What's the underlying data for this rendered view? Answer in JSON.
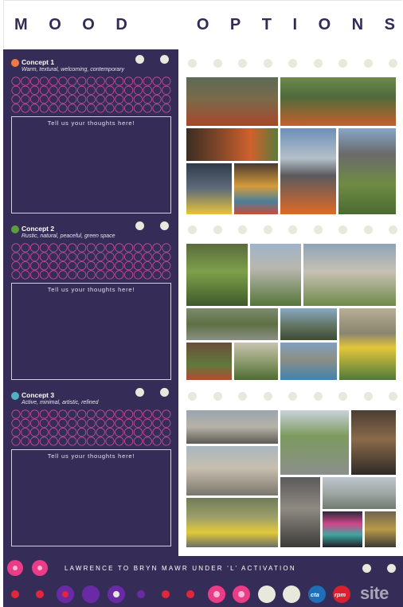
{
  "header": {
    "title_word1": [
      "M",
      "O",
      "O",
      "D"
    ],
    "title_word2": [
      "O",
      "P",
      "T",
      "I",
      "O",
      "N",
      "S"
    ]
  },
  "concepts": [
    {
      "title": "Concept 1",
      "subtitle": "Warm, textural, welcoming, contemporary",
      "dot_color": "#f07a3f",
      "box_label": "Tell us your thoughts here!"
    },
    {
      "title": "Concept 2",
      "subtitle": "Rustic, natural, peaceful, green space",
      "dot_color": "#5a9e3e",
      "box_label": "Tell us your thoughts here!"
    },
    {
      "title": "Concept 3",
      "subtitle": "Active, minimal, artistic, refined",
      "dot_color": "#4fb3c0",
      "box_label": "Tell us your thoughts here!"
    }
  ],
  "footer": {
    "text": "LAWRENCE TO BRYN MAWR UNDER ‘L’ ACTIVATION",
    "logos": [
      "cta",
      "rpm",
      "site"
    ]
  },
  "colors": {
    "panel": "#352d57",
    "accent_pink": "#ec3b87",
    "accent_purple": "#6a2aa6",
    "cream": "#e9e8dc",
    "red": "#e2263b"
  },
  "photo_groups": [
    {
      "concept": "Concept 1",
      "theme": "warm-under-track"
    },
    {
      "concept": "Concept 2",
      "theme": "green-under-track"
    },
    {
      "concept": "Concept 3",
      "theme": "active-under-track"
    }
  ]
}
